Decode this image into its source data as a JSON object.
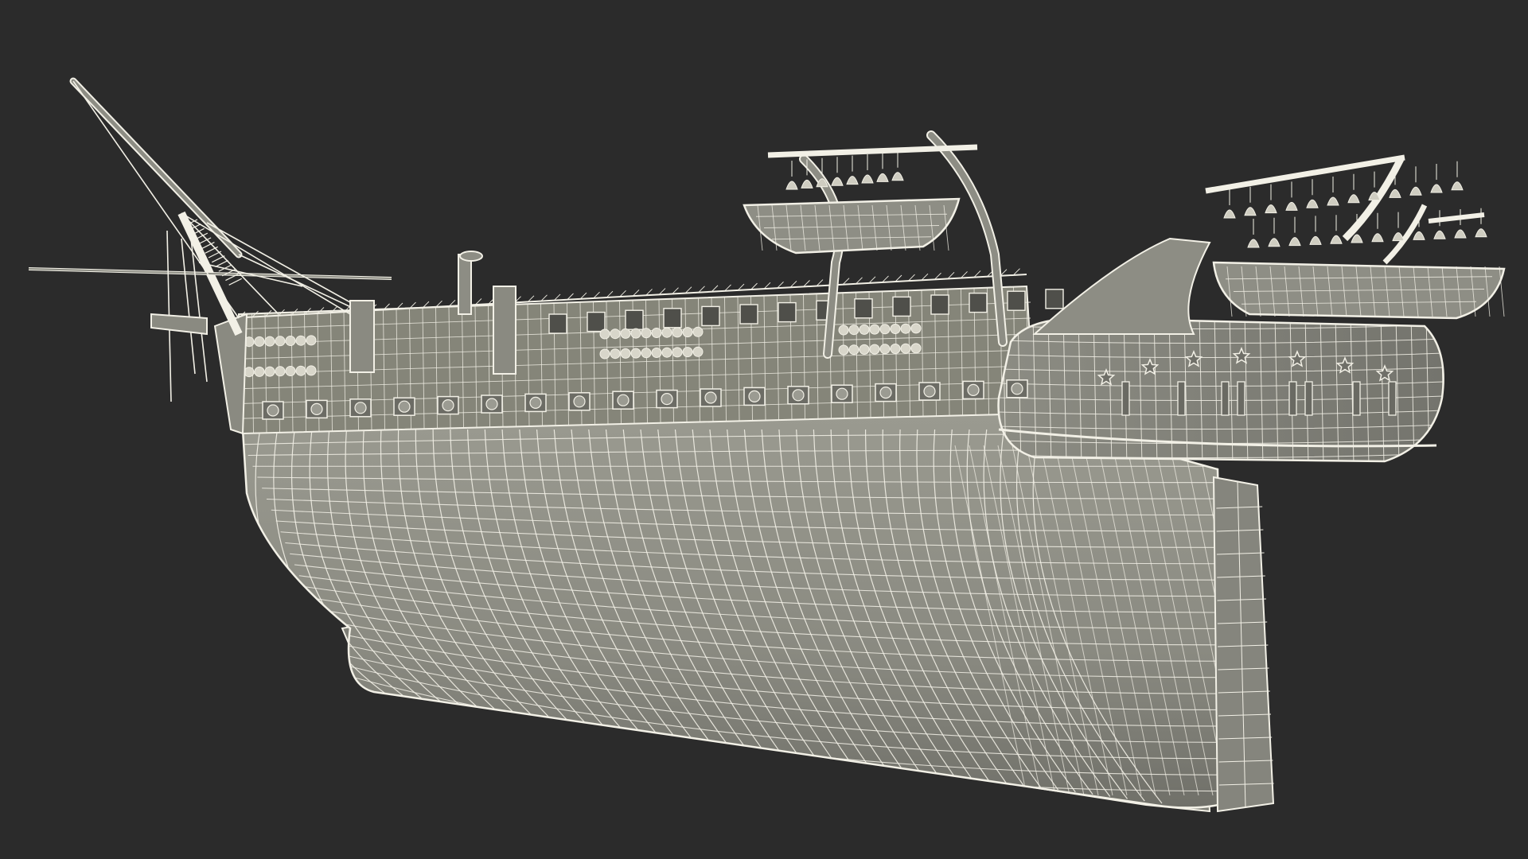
{
  "scene": {
    "subject": "wireframe-ship-hull",
    "colors": {
      "background": "#2b2b2b",
      "hull_fill": "#8f8f86",
      "hull_shade": "#6f6f68",
      "wire": "#f2f0e6",
      "wire_dim": "#c9c7bb"
    }
  }
}
